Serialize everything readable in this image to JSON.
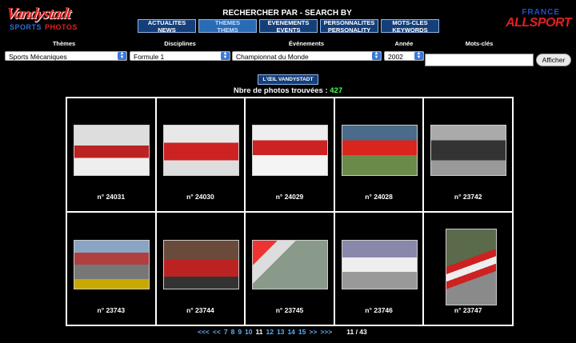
{
  "logo_left": {
    "script": "Vandystadt",
    "sub_a": "SPORTS",
    "sub_b": "PHOTOS"
  },
  "logo_right": {
    "line1": "FRANCE",
    "line2": "ALLSPORT"
  },
  "search": {
    "title": "RECHERCHER PAR  -  SEARCH BY",
    "buttons": [
      {
        "fr": "ACTUALITES",
        "en": "NEWS"
      },
      {
        "fr": "THEMES",
        "en": "THEMS"
      },
      {
        "fr": "EVENEMENTS",
        "en": "EVENTS"
      },
      {
        "fr": "PERSONNALITES",
        "en": "PERSONALITY"
      },
      {
        "fr": "MOTS-CLES",
        "en": "KEYWORDS"
      }
    ]
  },
  "filters": {
    "labels": {
      "themes": "Thèmes",
      "disciplines": "Disciplines",
      "evenements": "Événements",
      "annee": "Année",
      "mots": "Mots-clés"
    },
    "values": {
      "themes": "Sports Mécaniques",
      "disciplines": "Formule 1",
      "evenements": "Championnat du Monde",
      "annee": "2002"
    },
    "keyword_value": "",
    "submit": "Afficher"
  },
  "oeil_button": "L'ŒIL VANDYSTADT",
  "count": {
    "label": "Nbre de photos trouvées :",
    "value": "427"
  },
  "photos": [
    {
      "caption": "n° 24031"
    },
    {
      "caption": "n° 24030"
    },
    {
      "caption": "n° 24029"
    },
    {
      "caption": "n° 24028"
    },
    {
      "caption": "n° 23742"
    },
    {
      "caption": "n° 23743"
    },
    {
      "caption": "n° 23744"
    },
    {
      "caption": "n° 23745"
    },
    {
      "caption": "n° 23746"
    },
    {
      "caption": "n° 23747"
    }
  ],
  "pager": {
    "first": "<<<",
    "prev": "<<",
    "before": [
      "7",
      "8",
      "9",
      "10"
    ],
    "current": "11",
    "after": [
      "12",
      "13",
      "14",
      "15"
    ],
    "next": ">>",
    "last": ">>>",
    "total": "11 / 43"
  }
}
